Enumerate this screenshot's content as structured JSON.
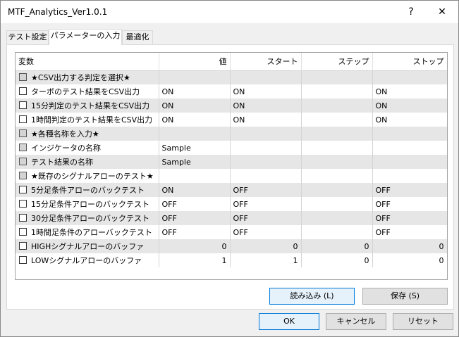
{
  "window": {
    "title": "MTF_Analytics_Ver1.0.1",
    "help_label": "?",
    "close_label": "✕"
  },
  "tabs": [
    {
      "label": "テスト設定"
    },
    {
      "label": "パラメーターの入力"
    },
    {
      "label": "最適化"
    }
  ],
  "table": {
    "headers": {
      "name": "変数",
      "value": "値",
      "start": "スタート",
      "step": "ステップ",
      "stop": "ストップ"
    },
    "rows": [
      {
        "kind": "group",
        "name": "★CSV出力する判定を選択★",
        "value": "",
        "start": "",
        "step": "",
        "stop": ""
      },
      {
        "kind": "item",
        "name": "ターボのテスト結果をCSV出力",
        "value": "ON",
        "start": "ON",
        "step": "",
        "stop": "ON"
      },
      {
        "kind": "item",
        "name": "15分判定のテスト結果をCSV出力",
        "value": "ON",
        "start": "ON",
        "step": "",
        "stop": "ON"
      },
      {
        "kind": "item",
        "name": "1時間判定のテスト結果をCSV出力",
        "value": "ON",
        "start": "ON",
        "step": "",
        "stop": "ON"
      },
      {
        "kind": "group",
        "name": "★各種名称を入力★",
        "value": "",
        "start": "",
        "step": "",
        "stop": ""
      },
      {
        "kind": "group",
        "name": "インジケータの名称",
        "value": "Sample",
        "start": "",
        "step": "",
        "stop": ""
      },
      {
        "kind": "group",
        "name": "テスト結果の名称",
        "value": "Sample",
        "start": "",
        "step": "",
        "stop": ""
      },
      {
        "kind": "group",
        "name": "★既存のシグナルアローのテスト★",
        "value": "",
        "start": "",
        "step": "",
        "stop": ""
      },
      {
        "kind": "item",
        "name": "5分足条件アローのバックテスト",
        "value": "ON",
        "start": "OFF",
        "step": "",
        "stop": "OFF"
      },
      {
        "kind": "item",
        "name": "15分足条件アローのバックテスト",
        "value": "OFF",
        "start": "OFF",
        "step": "",
        "stop": "OFF"
      },
      {
        "kind": "item",
        "name": "30分足条件アローのバックテスト",
        "value": "OFF",
        "start": "OFF",
        "step": "",
        "stop": "OFF"
      },
      {
        "kind": "item",
        "name": "1時間足条件のアローバックテスト",
        "value": "OFF",
        "start": "OFF",
        "step": "",
        "stop": "OFF"
      },
      {
        "kind": "item",
        "name": "HIGHシグナルアローのバッファ",
        "value": "0",
        "start": "0",
        "step": "0",
        "stop": "0",
        "numeric": true
      },
      {
        "kind": "item",
        "name": "LOWシグナルアローのバッファ",
        "value": "1",
        "start": "1",
        "step": "0",
        "stop": "0",
        "numeric": true
      }
    ]
  },
  "buttons": {
    "load": "読み込み (L)",
    "save": "保存 (S)",
    "ok": "OK",
    "cancel": "キャンセル",
    "reset": "リセット"
  }
}
